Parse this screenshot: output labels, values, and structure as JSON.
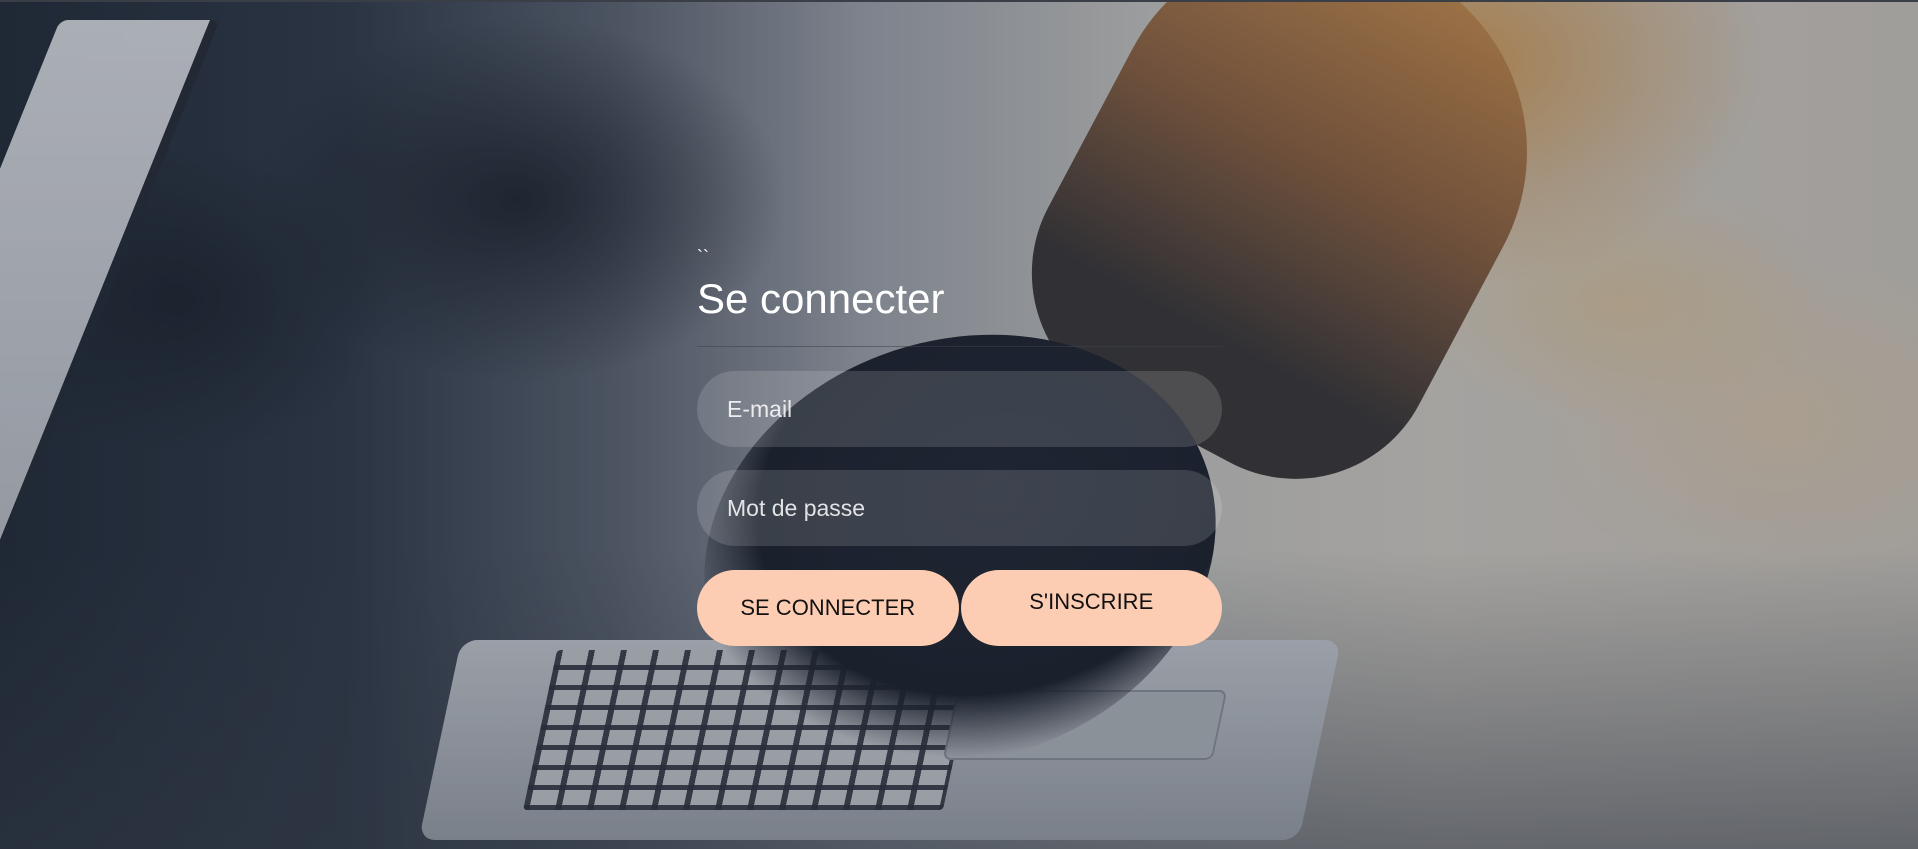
{
  "login": {
    "tick_mark": "``",
    "title": "Se connecter",
    "email_placeholder": "E-mail",
    "password_placeholder": "Mot de passe",
    "login_button": "SE CONNECTER",
    "signup_button": "S'INSCRIRE"
  },
  "colors": {
    "button_bg": "#fdcdb3",
    "title_text": "#ffffff"
  }
}
